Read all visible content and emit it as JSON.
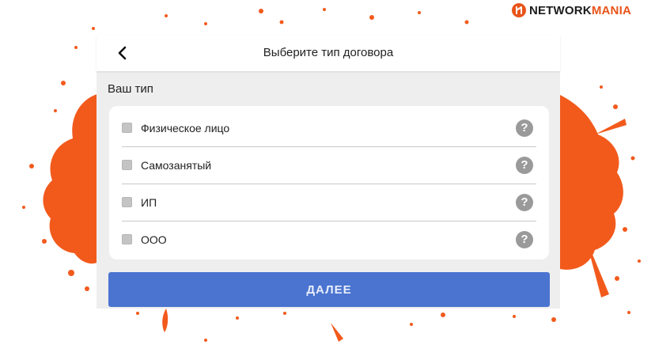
{
  "brand": {
    "text_main": "NETWORK",
    "text_accent": "MANIA",
    "accent_color": "#e8541a"
  },
  "header": {
    "title": "Выберите тип договора",
    "back_icon": "chevron-left-icon"
  },
  "section": {
    "label": "Ваш тип"
  },
  "options": [
    {
      "label": "Физическое лицо",
      "checked": false,
      "help_symbol": "?"
    },
    {
      "label": "Самозанятый",
      "checked": false,
      "help_symbol": "?"
    },
    {
      "label": "ИП",
      "checked": false,
      "help_symbol": "?"
    },
    {
      "label": "ООО",
      "checked": false,
      "help_symbol": "?"
    }
  ],
  "actions": {
    "next_label": "ДАЛЕЕ"
  },
  "colors": {
    "primary": "#4a74d0",
    "splash": "#f25a1c",
    "background": "#eeeeee"
  }
}
